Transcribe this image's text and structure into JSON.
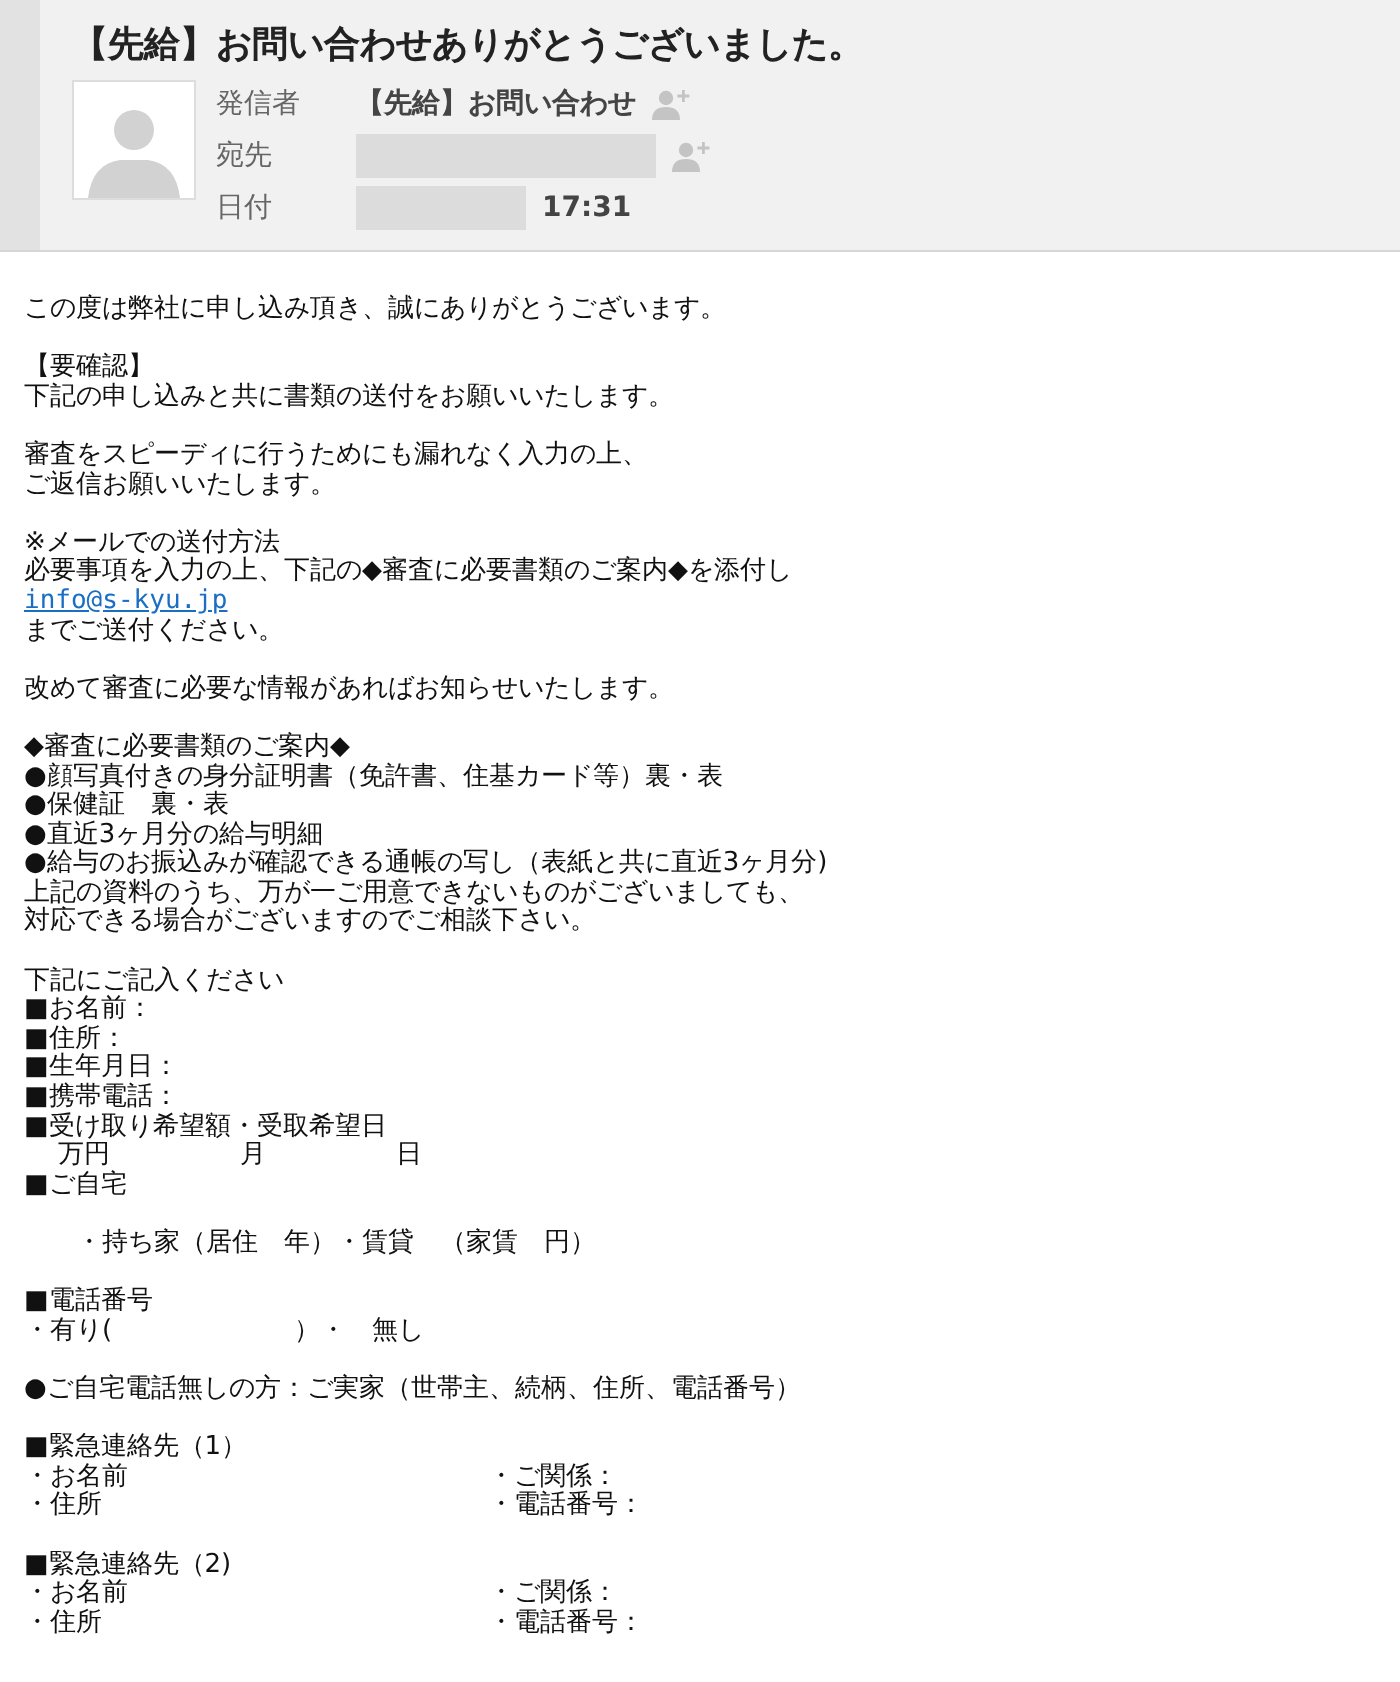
{
  "header": {
    "subject": "【先給】お問い合わせありがとうございました。",
    "fields": [
      {
        "kind": "sender",
        "label": "発信者",
        "value": "【先給】お問い合わせ",
        "redacted": false,
        "add_contact": true
      },
      {
        "kind": "to",
        "label": "宛先",
        "redacted": true,
        "add_contact": true
      },
      {
        "kind": "date",
        "label": "日付",
        "value": "17:31",
        "redacted": true,
        "add_contact": false
      }
    ]
  },
  "body": [
    [
      {
        "kind": "text",
        "text": "この度は弊社に申し込み頂き、誠にありがとうございます。"
      }
    ],
    [
      {
        "kind": "text",
        "text": "【要確認】"
      },
      {
        "kind": "text",
        "text": "下記の申し込みと共に書類の送付をお願いいたします。"
      }
    ],
    [
      {
        "kind": "text",
        "text": "審査をスピーディに行うためにも漏れなく入力の上、"
      },
      {
        "kind": "text",
        "text": "ご返信お願いいたします。"
      }
    ],
    [
      {
        "kind": "text",
        "text": "※メールでの送付方法"
      },
      {
        "kind": "text",
        "text": "必要事項を入力の上、下記の◆審査に必要書類のご案内◆を添付し"
      },
      {
        "kind": "link",
        "text": "info@s-kyu.jp"
      },
      {
        "kind": "text",
        "text": "までご送付ください。"
      }
    ],
    [
      {
        "kind": "text",
        "text": "改めて審査に必要な情報があればお知らせいたします。"
      }
    ],
    [
      {
        "kind": "text",
        "text": "◆審査に必要書類のご案内◆"
      },
      {
        "kind": "text",
        "text": "●顔写真付きの身分証明書（免許書、住基カード等）裏・表"
      },
      {
        "kind": "text",
        "text": "●保健証　裏・表"
      },
      {
        "kind": "text",
        "text": "●直近3ヶ月分の給与明細"
      },
      {
        "kind": "text",
        "text": "●給与のお振込みが確認できる通帳の写し（表紙と共に直近3ヶ月分)"
      },
      {
        "kind": "text",
        "text": "上記の資料のうち、万が一ご用意できないものがございましても、"
      },
      {
        "kind": "text",
        "text": "対応できる場合がございますのでご相談下さい。"
      }
    ],
    [
      {
        "kind": "text",
        "text": "下記にご記入ください"
      },
      {
        "kind": "text",
        "text": "■お名前："
      },
      {
        "kind": "text",
        "text": "■住所："
      },
      {
        "kind": "text",
        "text": "■生年月日："
      },
      {
        "kind": "text",
        "text": "■携帯電話："
      },
      {
        "kind": "text",
        "text": "■受け取り希望額・受取希望日"
      },
      {
        "kind": "text",
        "text": "　 万円　　　　　月　　　　　日"
      },
      {
        "kind": "text",
        "text": "■ご自宅"
      }
    ],
    [
      {
        "kind": "text",
        "text": "　　・持ち家（居住　年）・賃貸　（家賃　円）"
      }
    ],
    [
      {
        "kind": "text",
        "text": "■電話番号"
      },
      {
        "kind": "text",
        "text": "・有り(　　　　　　　）・　無し"
      }
    ],
    [
      {
        "kind": "text",
        "text": "●ご自宅電話無しの方：ご実家（世帯主、続柄、住所、電話番号）"
      }
    ],
    [
      {
        "kind": "text",
        "text": "■緊急連絡先（1）"
      },
      {
        "kind": "pair",
        "left": "・お名前",
        "right": "・ご関係："
      },
      {
        "kind": "pair",
        "left": "・住所",
        "right": "・電話番号："
      }
    ],
    [
      {
        "kind": "text",
        "text": "■緊急連絡先（2)"
      },
      {
        "kind": "pair",
        "left": "・お名前",
        "right": "・ご関係："
      },
      {
        "kind": "pair",
        "left": "・住所",
        "right": "・電話番号："
      }
    ]
  ]
}
